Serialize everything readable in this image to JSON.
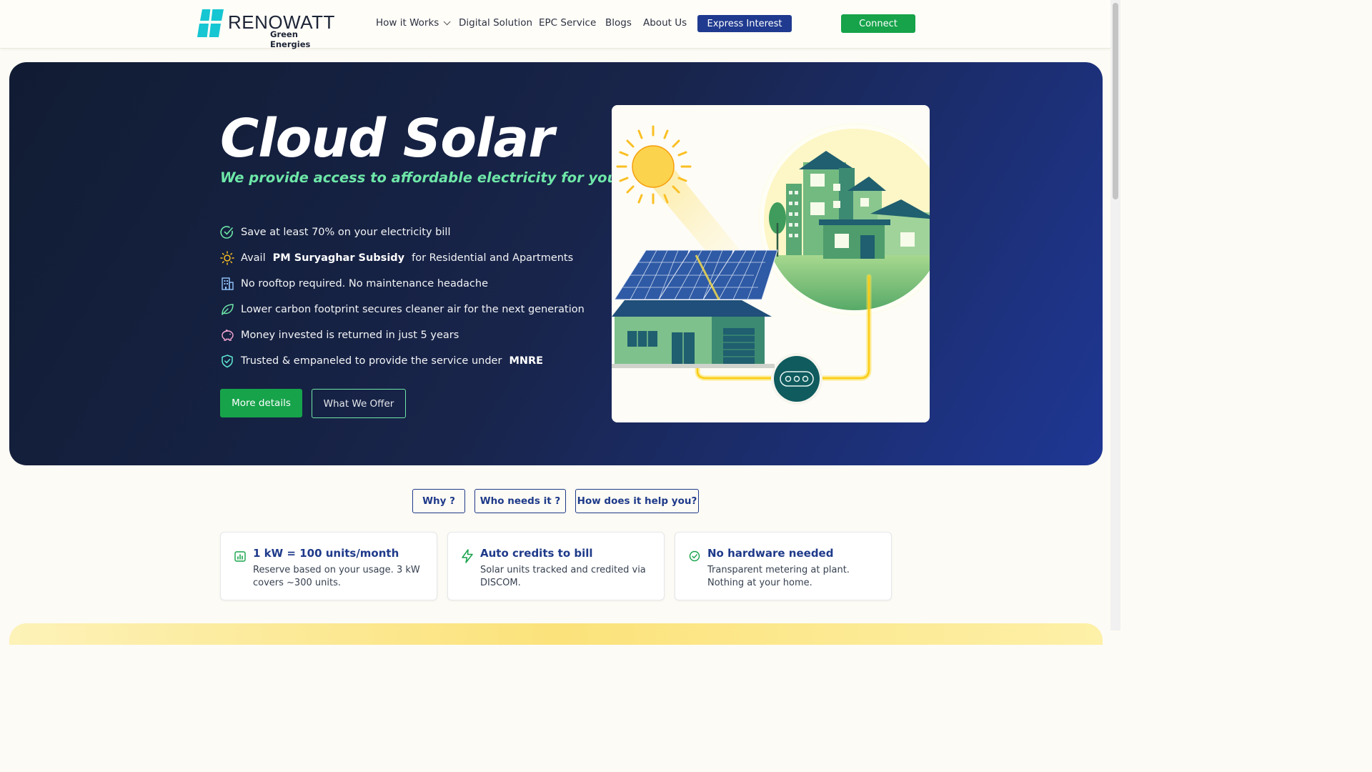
{
  "brand": {
    "name": "RENOWATT",
    "tagline": "Green Energies",
    "colors": {
      "navy": "#1f3a8f",
      "green": "#16a34a",
      "mint": "#6ee7a8",
      "logo_teal": "#16c6d2"
    }
  },
  "nav": {
    "items": [
      {
        "label": "How it Works",
        "has_dropdown": true
      },
      {
        "label": "Digital Solution"
      },
      {
        "label": "EPC Service"
      },
      {
        "label": "Blogs"
      },
      {
        "label": "About Us"
      }
    ],
    "express_label": "Express Interest",
    "connect_label": "Connect"
  },
  "hero": {
    "title": "Cloud Solar",
    "subtitle": "We provide access to affordable electricity for you",
    "benefits": [
      {
        "icon": "check-circle-icon",
        "text": "Save at least 70% on your electricity bill"
      },
      {
        "icon": "sun-icon",
        "prefix": "Avail",
        "bold": "PM Suryaghar Subsidy",
        "suffix": "for Residential and Apartments"
      },
      {
        "icon": "building-icon",
        "text": "No rooftop required. No maintenance headache"
      },
      {
        "icon": "leaf-icon",
        "text": "Lower carbon footprint secures cleaner air for the next generation"
      },
      {
        "icon": "piggy-bank-icon",
        "text": "Money invested is returned in just 5 years"
      },
      {
        "icon": "shield-check-icon",
        "prefix": "Trusted & empaneled to provide the service under",
        "bold": "MNRE"
      }
    ],
    "more_label": "More details",
    "offer_label": "What We Offer"
  },
  "tabs": [
    "Why ?",
    "Who needs it ?",
    "How does it help you?"
  ],
  "cards": [
    {
      "icon": "bar-chart-icon",
      "title": "1 kW = 100 units/month",
      "desc": "Reserve based on your usage. 3 kW covers ~300 units."
    },
    {
      "icon": "lightning-icon",
      "title": "Auto credits to bill",
      "desc": "Solar units tracked and credited via DISCOM."
    },
    {
      "icon": "check-circle-icon",
      "title": "No hardware needed",
      "desc": "Transparent metering at plant. Nothing at your home."
    }
  ]
}
